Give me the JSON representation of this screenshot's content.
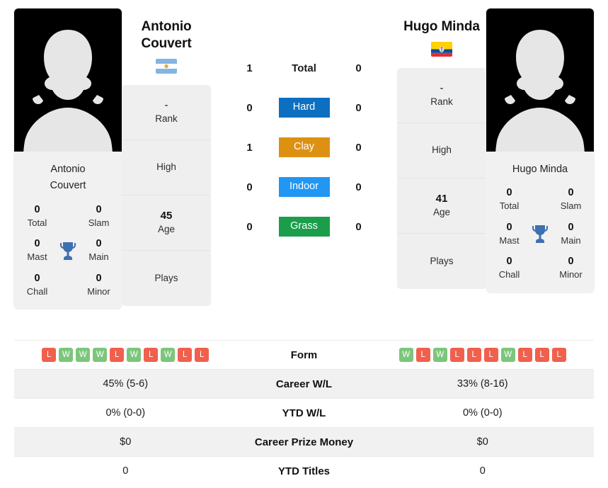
{
  "colors": {
    "hard": "#0d6fc0",
    "clay": "#dd9112",
    "indoor": "#2196f3",
    "grass": "#1a9e4b",
    "win": "#7cc67c",
    "loss": "#f0604d",
    "trophy": "#3e6fb0",
    "card_bg": "#efefef",
    "row_stripe": "#f1f1f1"
  },
  "players": {
    "left": {
      "name": "Antonio Couvert",
      "name_line1": "Antonio",
      "name_line2": "Couvert",
      "photo_caption_line1": "Antonio",
      "photo_caption_line2": "Couvert",
      "flag": "argentina-flag",
      "trophies": {
        "total_value": "0",
        "total_label": "Total",
        "slam_value": "0",
        "slam_label": "Slam",
        "mast_value": "0",
        "mast_label": "Mast",
        "main_value": "0",
        "main_label": "Main",
        "chall_value": "0",
        "chall_label": "Chall",
        "minor_value": "0",
        "minor_label": "Minor"
      },
      "info": [
        {
          "value": "-",
          "label": "Rank"
        },
        {
          "value": "",
          "label": "High"
        },
        {
          "value": "45",
          "label": "Age"
        },
        {
          "value": "",
          "label": "Plays"
        }
      ],
      "form": [
        "L",
        "W",
        "W",
        "W",
        "L",
        "W",
        "L",
        "W",
        "L",
        "L"
      ],
      "career_wl": "45% (5-6)",
      "ytd_wl": "0% (0-0)",
      "career_prize_money": "$0",
      "ytd_titles": "0"
    },
    "right": {
      "name": "Hugo Minda",
      "name_line1": "Hugo Minda",
      "name_line2": "",
      "photo_caption_line1": "Hugo Minda",
      "photo_caption_line2": "",
      "flag": "ecuador-flag",
      "trophies": {
        "total_value": "0",
        "total_label": "Total",
        "slam_value": "0",
        "slam_label": "Slam",
        "mast_value": "0",
        "mast_label": "Mast",
        "main_value": "0",
        "main_label": "Main",
        "chall_value": "0",
        "chall_label": "Chall",
        "minor_value": "0",
        "minor_label": "Minor"
      },
      "info": [
        {
          "value": "-",
          "label": "Rank"
        },
        {
          "value": "",
          "label": "High"
        },
        {
          "value": "41",
          "label": "Age"
        },
        {
          "value": "",
          "label": "Plays"
        }
      ],
      "form": [
        "W",
        "L",
        "W",
        "L",
        "L",
        "L",
        "W",
        "L",
        "L",
        "L"
      ],
      "career_wl": "33% (8-16)",
      "ytd_wl": "0% (0-0)",
      "career_prize_money": "$0",
      "ytd_titles": "0"
    }
  },
  "head_to_head": [
    {
      "label": "Total",
      "left": "1",
      "right": "0",
      "style": "plain"
    },
    {
      "label": "Hard",
      "left": "0",
      "right": "0",
      "style": "hard"
    },
    {
      "label": "Clay",
      "left": "1",
      "right": "0",
      "style": "clay"
    },
    {
      "label": "Indoor",
      "left": "0",
      "right": "0",
      "style": "indoor"
    },
    {
      "label": "Grass",
      "left": "0",
      "right": "0",
      "style": "grass"
    }
  ],
  "stats_rows": [
    {
      "label": "Form",
      "type": "form"
    },
    {
      "label": "Career W/L",
      "type": "text",
      "left": "45% (5-6)",
      "right": "33% (8-16)"
    },
    {
      "label": "YTD W/L",
      "type": "text",
      "left": "0% (0-0)",
      "right": "0% (0-0)"
    },
    {
      "label": "Career Prize Money",
      "type": "text",
      "left": "$0",
      "right": "$0"
    },
    {
      "label": "YTD Titles",
      "type": "text",
      "left": "0",
      "right": "0"
    }
  ]
}
